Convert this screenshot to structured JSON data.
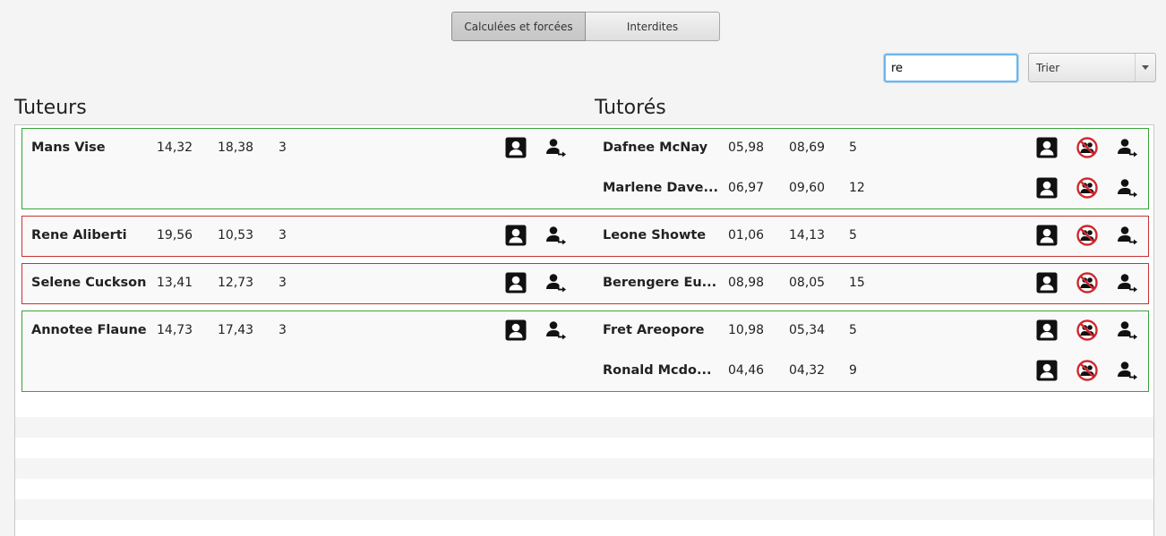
{
  "tabs": [
    {
      "label": "Calculées et forcées",
      "selected": true
    },
    {
      "label": "Interdites",
      "selected": false
    }
  ],
  "search": {
    "value": "re"
  },
  "sort": {
    "label": "Trier"
  },
  "headings": {
    "tutors": "Tuteurs",
    "tutees": "Tutorés"
  },
  "groups": [
    {
      "status": "green",
      "tutor": {
        "name": "Mans Vise",
        "v1": "14,32",
        "v2": "18,38",
        "v3": "3"
      },
      "tutees": [
        {
          "name": "Dafnee McNay",
          "v1": "05,98",
          "v2": "08,69",
          "v3": "5"
        },
        {
          "name": "Marlene Dave...",
          "v1": "06,97",
          "v2": "09,60",
          "v3": "12"
        }
      ]
    },
    {
      "status": "red",
      "tutor": {
        "name": "Rene Aliberti",
        "v1": "19,56",
        "v2": "10,53",
        "v3": "3"
      },
      "tutees": [
        {
          "name": "Leone Showte",
          "v1": "01,06",
          "v2": "14,13",
          "v3": "5"
        }
      ]
    },
    {
      "status": "red",
      "tutor": {
        "name": "Selene Cuckson",
        "v1": "13,41",
        "v2": "12,73",
        "v3": "3"
      },
      "tutees": [
        {
          "name": "Berengere Eu...",
          "v1": "08,98",
          "v2": "08,05",
          "v3": "15"
        }
      ]
    },
    {
      "status": "green",
      "tutor": {
        "name": "Annotee Flaune",
        "v1": "14,73",
        "v2": "17,43",
        "v3": "3"
      },
      "tutees": [
        {
          "name": "Fret Areopore",
          "v1": "10,98",
          "v2": "05,34",
          "v3": "5"
        },
        {
          "name": "Ronald Mcdo...",
          "v1": "04,46",
          "v2": "04,32",
          "v3": "9"
        }
      ]
    }
  ],
  "colors": {
    "green_border": "#3aa33a",
    "red_border": "#c83232",
    "forbid_red": "#d0282e"
  },
  "icons": {
    "profile": "profile-card-icon",
    "transfer": "person-transfer-icon",
    "forbid": "forbid-pair-icon"
  }
}
